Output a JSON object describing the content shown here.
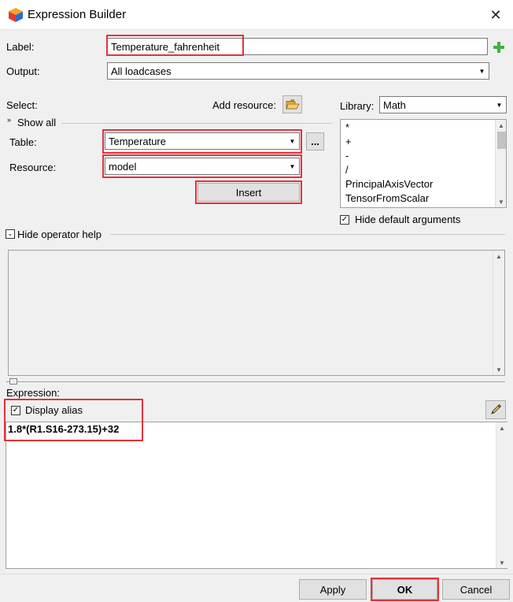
{
  "window": {
    "title": "Expression Builder"
  },
  "icons": {
    "app": "app-cube-icon",
    "close": "close-icon",
    "add": "plus-icon",
    "folder": "folder-open-icon",
    "more": "ellipsis-icon",
    "edit": "pencil-icon"
  },
  "form": {
    "label_caption": "Label:",
    "label_value": "Temperature_fahrenheit",
    "output_caption": "Output:",
    "output_value": "All loadcases"
  },
  "select": {
    "caption": "Select:",
    "add_resource": "Add resource:",
    "show_all": "Show all",
    "table_caption": "Table:",
    "table_value": "Temperature",
    "resource_caption": "Resource:",
    "resource_value": "model",
    "insert_label": "Insert",
    "more_label": "..."
  },
  "library": {
    "caption": "Library:",
    "value": "Math",
    "items": [
      "*",
      "+",
      "-",
      "/",
      "PrincipalAxisVector",
      "TensorFromScalar"
    ],
    "hide_default_args": "Hide default arguments"
  },
  "operator_help": {
    "label": "Hide operator help"
  },
  "expression": {
    "caption": "Expression:",
    "display_alias": "Display alias",
    "text": "1.8*(R1.S16-273.15)+32"
  },
  "footer": {
    "apply": "Apply",
    "ok": "OK",
    "cancel": "Cancel"
  },
  "colors": {
    "highlight": "#e3323b",
    "plus_icon": "#3cb43c",
    "folder_icon": "#e8b64c"
  }
}
